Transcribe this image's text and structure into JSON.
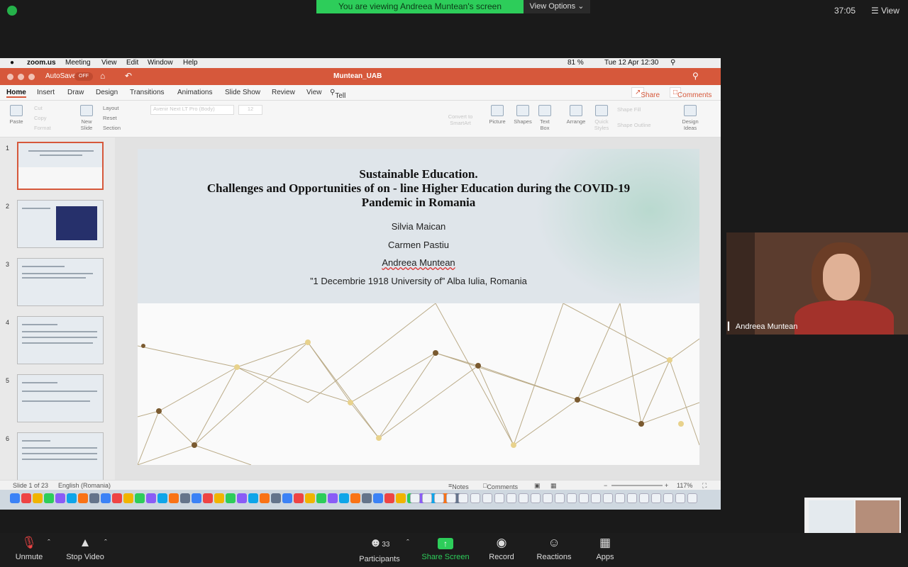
{
  "zoom": {
    "banner": "You are viewing Andreea Muntean's screen",
    "view_options": "View Options",
    "timer": "37:05",
    "view_label": "View",
    "participant_name": "Andreea Muntean",
    "participants_count": "33",
    "toolbar": {
      "unmute": "Unmute",
      "stop_video": "Stop Video",
      "participants": "Participants",
      "share_screen": "Share Screen",
      "record": "Record",
      "reactions": "Reactions",
      "apps": "Apps"
    },
    "colors": {
      "banner_green": "#2dcd5a",
      "share_green": "#2dcd5a",
      "ppt_orange": "#d6583b"
    }
  },
  "mac_menu": {
    "app": "zoom.us",
    "items": [
      "Meeting",
      "View",
      "Edit",
      "Window",
      "Help"
    ],
    "battery": "81 %",
    "datetime": "Tue 12 Apr  12:30"
  },
  "ppt": {
    "autosave": "AutoSave",
    "autosave_state": "OFF",
    "filename": "Muntean_UAB",
    "tabs": [
      "Home",
      "Insert",
      "Draw",
      "Design",
      "Transitions",
      "Animations",
      "Slide Show",
      "Review",
      "View"
    ],
    "tell_me": "Tell me",
    "share": "Share",
    "comments": "Comments",
    "ribbon": {
      "paste": "Paste",
      "cut": "Cut",
      "copy": "Copy",
      "format": "Format",
      "new_slide": "New Slide",
      "layout": "Layout",
      "reset": "Reset",
      "section": "Section",
      "font": "Avenir Next LT Pro (Body)",
      "font_size": "12",
      "convert": "Convert to SmartArt",
      "picture": "Picture",
      "shapes": "Shapes",
      "text_box": "Text Box",
      "arrange": "Arrange",
      "quick_styles": "Quick Styles",
      "shape_fill": "Shape Fill",
      "shape_outline": "Shape Outline",
      "design_ideas": "Design Ideas"
    },
    "slide_numbers": [
      "1",
      "2",
      "3",
      "4",
      "5",
      "6"
    ],
    "slide": {
      "title_1": "Sustainable Education.",
      "title_2": "Challenges and Opportunities of on - line Higher Education  during the COVID-19",
      "title_3": "Pandemic in Romania",
      "authors": [
        "Silvia Maican",
        "Carmen Pastiu",
        "Andreea Muntean"
      ],
      "affiliation": "”1 Decembrie 1918 University of” Alba Iulia, Romania"
    },
    "status": {
      "slide_of": "Slide 1 of 23",
      "language": "English (Romania)",
      "notes": "Notes",
      "comments": "Comments",
      "zoom": "117%"
    }
  }
}
